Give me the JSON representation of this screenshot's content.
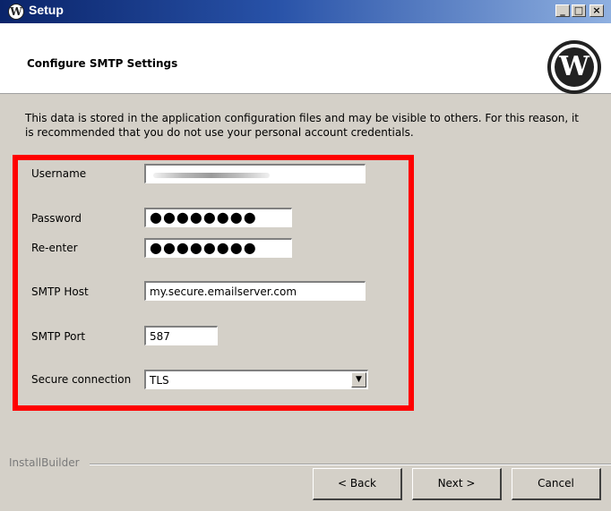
{
  "window": {
    "title": "Setup"
  },
  "header": {
    "title": "Configure SMTP Settings"
  },
  "description": "This data is stored in the application configuration files and may be visible to others. For this reason, it is recommended that you do not use your personal account credentials.",
  "form": {
    "username_label": "Username",
    "username_value": "",
    "password_label": "Password",
    "password_value": "●●●●●●●●",
    "reenter_label": "Re-enter",
    "reenter_value": "●●●●●●●●",
    "smtp_host_label": "SMTP Host",
    "smtp_host_value": "my.secure.emailserver.com",
    "smtp_port_label": "SMTP Port",
    "smtp_port_value": "587",
    "secure_label": "Secure connection",
    "secure_value": "TLS"
  },
  "footer": {
    "brand": "InstallBuilder",
    "back_label": "< Back",
    "next_label": "Next >",
    "cancel_label": "Cancel"
  },
  "colors": {
    "highlight": "#ff0000",
    "titlebar_start": "#0a246a",
    "titlebar_end": "#8fb0e0"
  },
  "icons": {
    "app": "wordpress-icon",
    "logo": "wordpress-logo"
  }
}
